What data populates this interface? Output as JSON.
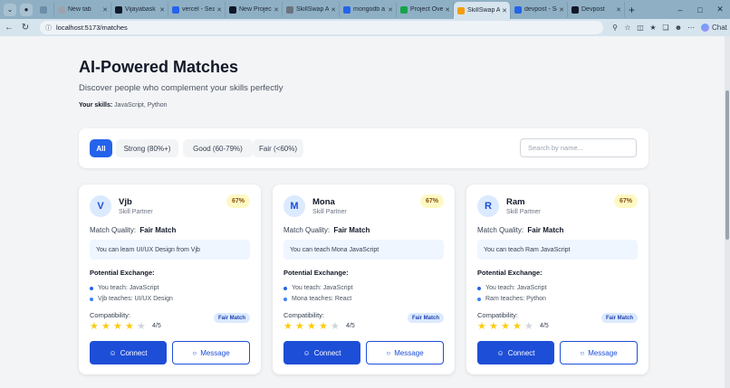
{
  "browser": {
    "tabs": [
      {
        "label": "",
        "color": "#6b8fa8",
        "small": true
      },
      {
        "label": "New tab",
        "color": "#9ca3af"
      },
      {
        "label": "Vijayabask",
        "color": "#111827"
      },
      {
        "label": "vercel - Sea",
        "color": "#2563eb"
      },
      {
        "label": "New Project",
        "color": "#111827"
      },
      {
        "label": "SkillSwap AI",
        "color": "#6b7280"
      },
      {
        "label": "mongodb a",
        "color": "#2563eb"
      },
      {
        "label": "Project Ove",
        "color": "#16a34a"
      },
      {
        "label": "SkillSwap AI",
        "color": "#f59e0b",
        "active": true
      },
      {
        "label": "devpost - Se",
        "color": "#2563eb"
      },
      {
        "label": "Devpost",
        "color": "#111827"
      }
    ],
    "url": "localhost:5173/matches",
    "chat_label": "Chat"
  },
  "header": {
    "title": "AI-Powered Matches",
    "subtitle": "Discover people who complement your skills perfectly",
    "skills_label": "Your skills:",
    "skills_value": "JavaScript, Python"
  },
  "filters": {
    "all": "All",
    "strong": "Strong (80%+)",
    "good": "Good (60-79%)",
    "fair": "Fair (<60%)",
    "search_placeholder": "Search by name..."
  },
  "cards": [
    {
      "initial": "V",
      "name": "Vjb",
      "role": "Skill Partner",
      "score": "67%",
      "quality_label": "Match Quality:",
      "quality": "Fair Match",
      "learn": "You can learn UI/UX Design from Vjb",
      "exchange_title": "Potential Exchange:",
      "teach": "You teach: JavaScript",
      "they_teach": "Vjb teaches: UI/UX Design",
      "compat_label": "Compatibility:",
      "badge": "Fair Match",
      "stars": 4,
      "rating": "4/5",
      "connect": "Connect",
      "message": "Message"
    },
    {
      "initial": "M",
      "name": "Mona",
      "role": "Skill Partner",
      "score": "67%",
      "quality_label": "Match Quality:",
      "quality": "Fair Match",
      "learn": "You can teach Mona JavaScript",
      "exchange_title": "Potential Exchange:",
      "teach": "You teach: JavaScript",
      "they_teach": "Mona teaches: React",
      "compat_label": "Compatibility:",
      "badge": "Fair Match",
      "stars": 4,
      "rating": "4/5",
      "connect": "Connect",
      "message": "Message"
    },
    {
      "initial": "R",
      "name": "Ram",
      "role": "Skill Partner",
      "score": "67%",
      "quality_label": "Match Quality:",
      "quality": "Fair Match",
      "learn": "You can teach Ram JavaScript",
      "exchange_title": "Potential Exchange:",
      "teach": "You teach: JavaScript",
      "they_teach": "Ram teaches: Python",
      "compat_label": "Compatibility:",
      "badge": "Fair Match",
      "stars": 4,
      "rating": "4/5",
      "connect": "Connect",
      "message": "Message"
    }
  ],
  "colors": {
    "accent": "#2563eb",
    "teach_dot": "#2563eb",
    "learn_dot": "#3b82f6"
  }
}
